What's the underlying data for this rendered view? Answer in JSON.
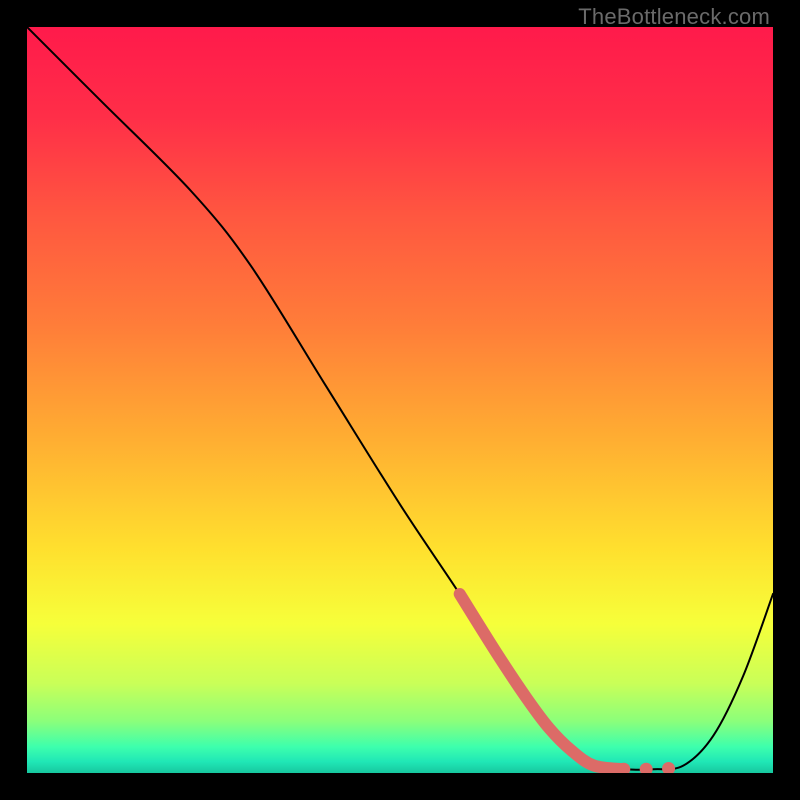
{
  "watermark": "TheBottleneck.com",
  "chart_data": {
    "type": "line",
    "title": "",
    "xlabel": "",
    "ylabel": "",
    "xlim": [
      0,
      100
    ],
    "ylim": [
      0,
      100
    ],
    "grid": false,
    "legend": false,
    "series": [
      {
        "name": "curve",
        "color": "#000000",
        "x": [
          0,
          10,
          22,
          30,
          40,
          50,
          58,
          63,
          67,
          70,
          73,
          76,
          80,
          84,
          88,
          92,
          96,
          100
        ],
        "values": [
          100,
          90,
          78,
          68,
          52,
          36,
          24,
          16,
          10,
          6,
          3,
          1,
          0.5,
          0.5,
          1,
          5,
          13,
          24
        ]
      }
    ],
    "highlight": {
      "name": "salmon-segment",
      "color": "#dc6b67",
      "x": [
        58,
        63,
        67,
        70,
        73,
        76,
        80
      ],
      "values": [
        24,
        16,
        10,
        6,
        3,
        1,
        0.5
      ]
    },
    "dots": {
      "name": "salmon-dots",
      "color": "#dc6b67",
      "points": [
        {
          "x": 80,
          "y": 0.5
        },
        {
          "x": 83,
          "y": 0.5
        },
        {
          "x": 86,
          "y": 0.6
        }
      ]
    },
    "gradient_stops": [
      {
        "offset": 0.0,
        "color": "#ff1a4b"
      },
      {
        "offset": 0.12,
        "color": "#ff2e48"
      },
      {
        "offset": 0.25,
        "color": "#ff5640"
      },
      {
        "offset": 0.4,
        "color": "#ff7d39"
      },
      {
        "offset": 0.55,
        "color": "#ffad32"
      },
      {
        "offset": 0.7,
        "color": "#ffe02e"
      },
      {
        "offset": 0.8,
        "color": "#f6ff3a"
      },
      {
        "offset": 0.88,
        "color": "#c9ff58"
      },
      {
        "offset": 0.93,
        "color": "#8cff7a"
      },
      {
        "offset": 0.965,
        "color": "#3dffad"
      },
      {
        "offset": 0.985,
        "color": "#20e7b6"
      },
      {
        "offset": 1.0,
        "color": "#17c79f"
      }
    ]
  }
}
